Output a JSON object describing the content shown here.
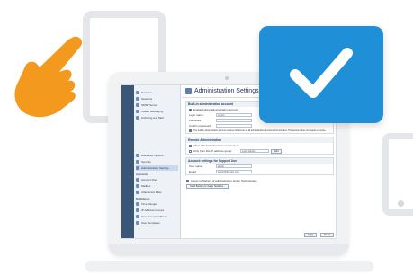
{
  "screen": {
    "title": "Administration Settings",
    "sidebar": {
      "items": [
        {
          "label": "Services",
          "active": false
        },
        {
          "label": "Sessions",
          "active": false
        },
        {
          "label": "SMSP Server",
          "active": false
        },
        {
          "label": "Instant Messaging",
          "active": false
        },
        {
          "label": "Archiving and Mail",
          "active": false
        }
      ],
      "items2": [
        {
          "label": "Advanced Options",
          "active": false
        },
        {
          "label": "Security",
          "active": false
        },
        {
          "label": "Administration Settings",
          "active": true
        }
      ],
      "section_accounts": "Accounts",
      "items3": [
        {
          "label": "Account Files",
          "active": false
        },
        {
          "label": "Mailbox",
          "active": false
        },
        {
          "label": "Attachment Filter",
          "active": false
        }
      ],
      "section_definitions": "Definitions",
      "items4": [
        {
          "label": "Time Ranges",
          "active": false
        },
        {
          "label": "IP Address Groups",
          "active": false
        },
        {
          "label": "User Groups/Address",
          "active": false
        },
        {
          "label": "User Templates",
          "active": false
        }
      ]
    },
    "panel1": {
      "head": "Built-in administration account",
      "enable_label": "Enable built-in administration account",
      "login_label": "Login name:",
      "login_value": "Admin",
      "password_label": "Password:",
      "confirm_label": "Confirm password:",
      "note": "The built-in administration account ensures full access to all administration and account's domains. This account does not require a license."
    },
    "panel2": {
      "head": "Remote Administration",
      "allow_label": "Allow administration from remote host",
      "only_label": "Only from this IP address group:",
      "select_value": "Local clients",
      "edit_label": "Edit"
    },
    "panel3": {
      "head": "Account settings for Support Use",
      "username_label": "User name:",
      "username_value": "admin",
      "email_label": "Email:",
      "email_value": "admin@domain.com"
    },
    "panel4": {
      "publish_label": "Import publishers of administration and/or Technologies",
      "button": "Send Backup & Usage Statistics..."
    },
    "footer": {
      "apply": "Apply",
      "reset": "Reset"
    }
  },
  "colors": {
    "badge": "#1f8fd8",
    "hand": "#f39a1e",
    "sidebar": "#3b5777"
  },
  "icons": {
    "badge": "checkmark-icon",
    "hand": "pointing-hand-icon"
  }
}
